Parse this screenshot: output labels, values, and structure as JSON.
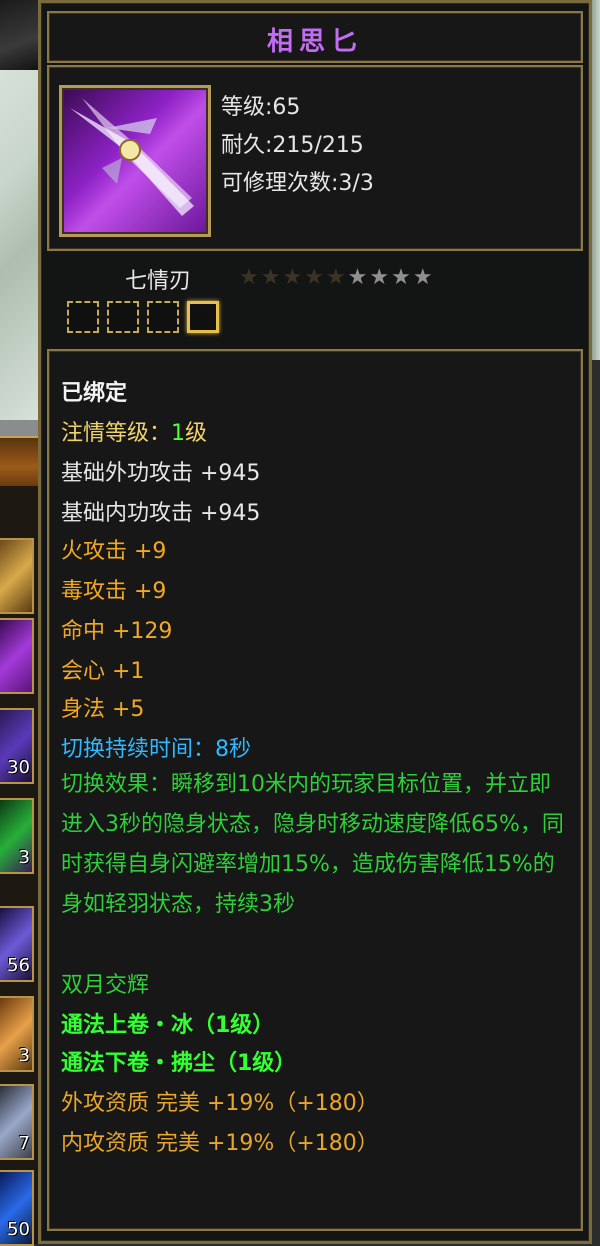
{
  "title": "相思匕",
  "stats": {
    "level": "等级:65",
    "durability": "耐久:215/215",
    "repair_count": "可修理次数:3/3"
  },
  "sub_name": "七情刃",
  "stars": [
    "★",
    "★",
    "★",
    "★",
    "★",
    "★",
    "★",
    "★",
    "★"
  ],
  "attrs": {
    "bound": "已绑定",
    "love_level_label": "注情等级：",
    "love_level_num": "1",
    "love_level_unit": "级",
    "base_ext_atk": "基础外功攻击  +945",
    "base_int_atk": "基础内功攻击  +945",
    "fire_atk": "火攻击  +9",
    "poison_atk": "毒攻击  +9",
    "hit": "命中  +129",
    "crit": "会心  +1",
    "agility": "身法  +5",
    "switch_duration": "切换持续时间：8秒",
    "switch_effect": "切换效果：瞬移到10米内的玩家目标位置，并立即进入3秒的隐身状态，隐身时移动速度降低65%，同时获得自身闪避率增加15%，造成伤害降低15%的身如轻羽状态，持续3秒",
    "set_name": "双月交辉",
    "skill_1": "通法上卷・冰（1级）",
    "skill_2": "通法下卷・拂尘（1级）",
    "ext_quality": "外攻资质  完美 +19%（+180）",
    "int_quality": "内攻资质  完美 +19%（+180）"
  },
  "side_counts": [
    "30",
    "3",
    "56",
    "3",
    "7",
    "50"
  ],
  "colors": {
    "title": "#c26cf2",
    "yellow": "#f0d36a",
    "orange": "#f2a822",
    "blue": "#33b7ff",
    "green": "#2fcf3a",
    "bright_green": "#33ff33",
    "frame": "#8a7847"
  }
}
